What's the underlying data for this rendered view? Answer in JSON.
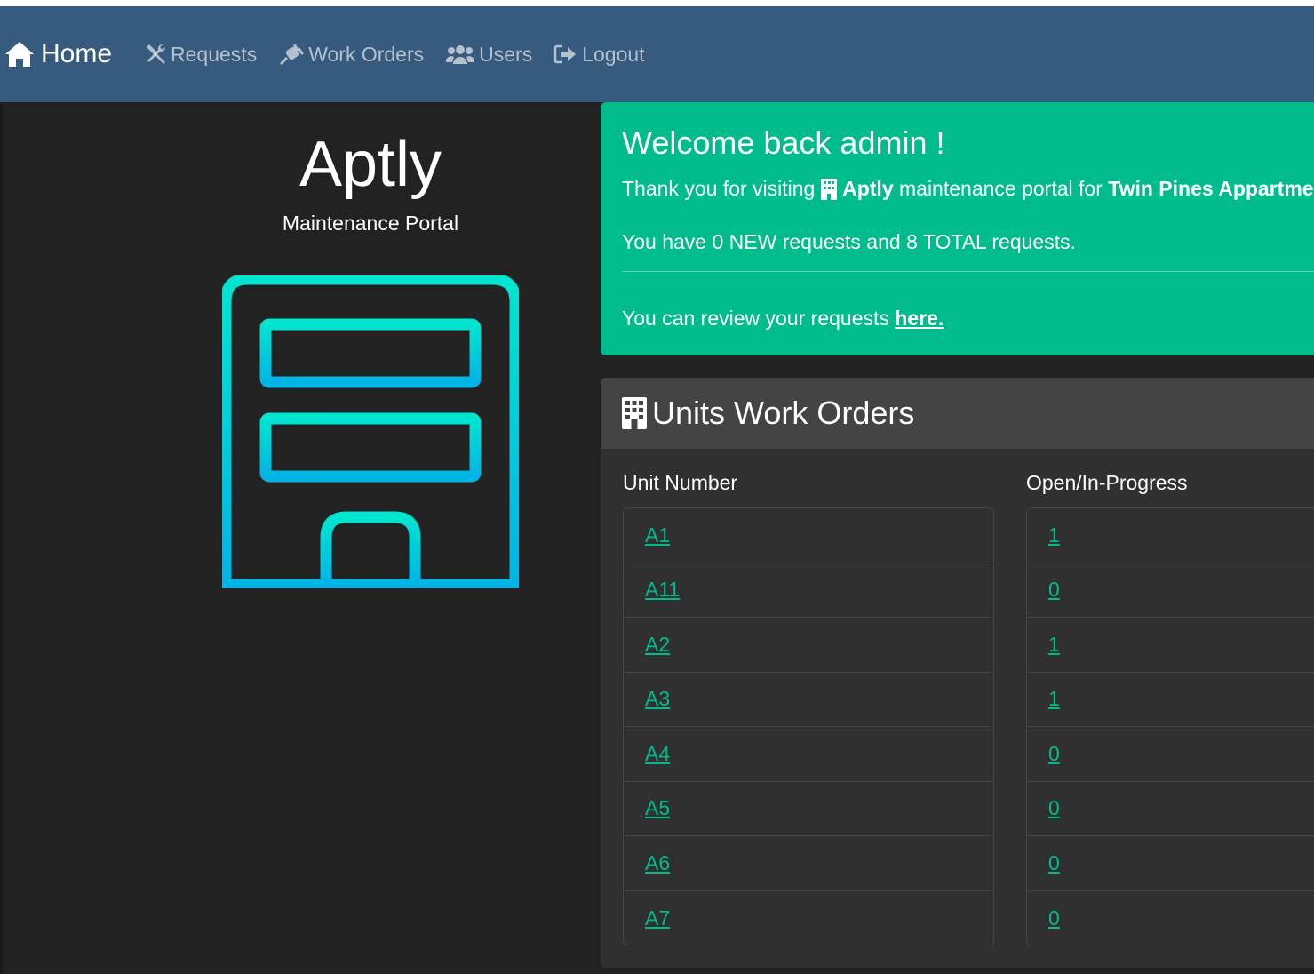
{
  "nav": {
    "brand": "Home",
    "links": [
      {
        "label": "Requests",
        "icon": "tools-icon"
      },
      {
        "label": "Work Orders",
        "icon": "plug-icon"
      },
      {
        "label": "Users",
        "icon": "users-icon"
      },
      {
        "label": "Logout",
        "icon": "logout-icon"
      }
    ]
  },
  "sidebar": {
    "title": "Aptly",
    "subtitle": "Maintenance Portal",
    "logo_icon": "building-icon",
    "logo_gradient": [
      "#00e5d0",
      "#00b4e6"
    ]
  },
  "welcome": {
    "heading": "Welcome back admin !",
    "line1_prefix": "Thank you for visiting",
    "line1_brand": "Aptly",
    "line1_middle": "maintenance portal for",
    "line1_property": "Twin Pines Appartments",
    "line2": "You have 0 NEW requests and 8 TOTAL requests.",
    "line3_prefix": "You can review your requests",
    "line3_link": "here."
  },
  "units_card": {
    "title": "Units Work Orders",
    "columns": [
      "Unit Number",
      "Open/In-Progress"
    ],
    "rows": [
      {
        "unit": "A1",
        "open": "1"
      },
      {
        "unit": "A11",
        "open": "0"
      },
      {
        "unit": "A2",
        "open": "1"
      },
      {
        "unit": "A3",
        "open": "1"
      },
      {
        "unit": "A4",
        "open": "0"
      },
      {
        "unit": "A5",
        "open": "0"
      },
      {
        "unit": "A6",
        "open": "0"
      },
      {
        "unit": "A7",
        "open": "0"
      }
    ]
  },
  "colors": {
    "navbar": "#375a7f",
    "accent": "#00bc8c",
    "background": "#222222",
    "card": "#303030",
    "card_header": "#444444"
  }
}
